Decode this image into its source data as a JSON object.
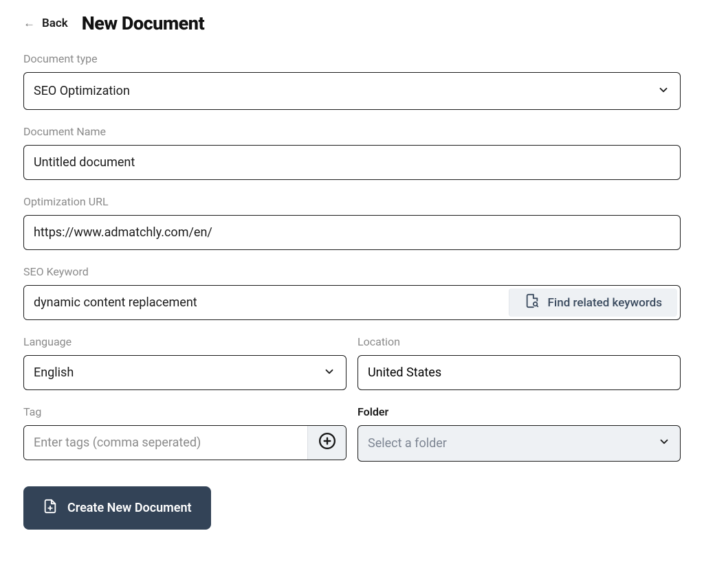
{
  "header": {
    "back_label": "Back",
    "title": "New Document"
  },
  "form": {
    "document_type": {
      "label": "Document type",
      "value": "SEO Optimization"
    },
    "document_name": {
      "label": "Document Name",
      "value": "Untitled document"
    },
    "optimization_url": {
      "label": "Optimization URL",
      "value": "https://www.admatchly.com/en/"
    },
    "seo_keyword": {
      "label": "SEO Keyword",
      "value": "dynamic content replacement",
      "find_button": "Find related keywords"
    },
    "language": {
      "label": "Language",
      "value": "English"
    },
    "location": {
      "label": "Location",
      "value": "United States"
    },
    "tag": {
      "label": "Tag",
      "placeholder": "Enter tags (comma seperated)"
    },
    "folder": {
      "label": "Folder",
      "placeholder": "Select a folder"
    },
    "submit_label": "Create New Document"
  }
}
